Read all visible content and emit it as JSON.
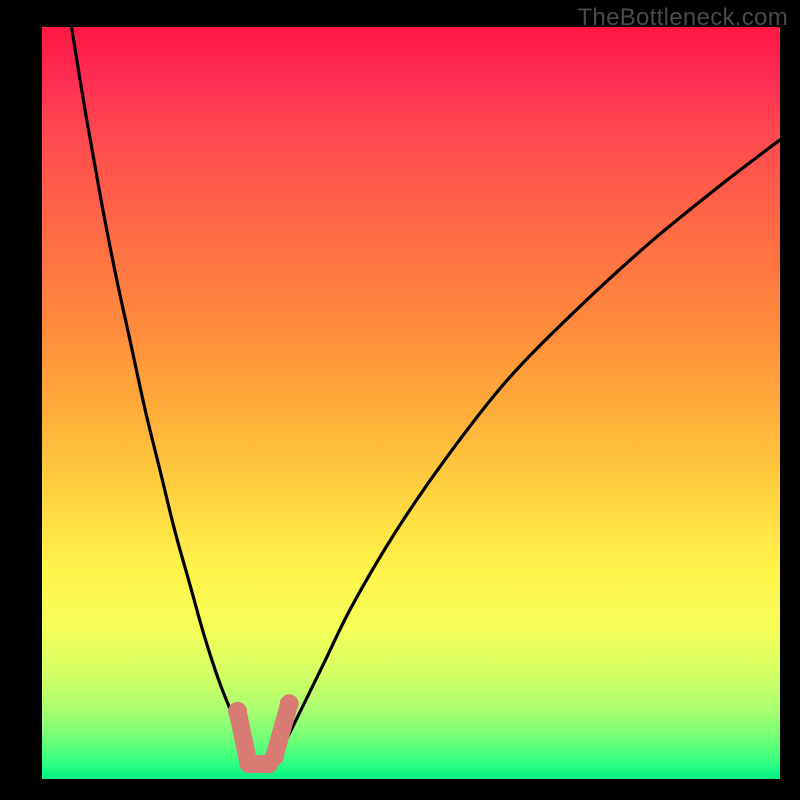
{
  "watermark": "TheBottleneck.com",
  "colors": {
    "background": "#000000",
    "gradient_top": "#ff1744",
    "gradient_mid1": "#ff8b3c",
    "gradient_mid2": "#fff34a",
    "gradient_bottom": "#00ef86",
    "curve": "#000000",
    "marker": "#d87b74"
  },
  "chart_data": {
    "type": "line",
    "title": "",
    "xlabel": "",
    "ylabel": "",
    "xlim": [
      0,
      100
    ],
    "ylim": [
      0,
      100
    ],
    "series": [
      {
        "name": "bottleneck-curve",
        "x": [
          4,
          6,
          8,
          10,
          12,
          14,
          16,
          18,
          20,
          22,
          24,
          26,
          27,
          28,
          29,
          30,
          31,
          32,
          33,
          35,
          38,
          42,
          48,
          55,
          63,
          72,
          82,
          92,
          100
        ],
        "y": [
          100,
          88,
          77,
          67,
          58,
          49,
          41,
          33,
          26,
          19,
          13,
          8,
          5,
          3,
          2,
          2,
          2,
          3,
          5,
          9,
          15,
          23,
          33,
          43,
          53,
          62,
          71,
          79,
          85
        ]
      }
    ],
    "markers": [
      {
        "name": "left-cluster",
        "x_range": [
          26.5,
          29.5
        ],
        "y_range": [
          2,
          9
        ]
      },
      {
        "name": "right-cluster",
        "x_range": [
          31.5,
          33.5
        ],
        "y_range": [
          3,
          10
        ]
      }
    ],
    "annotations": []
  }
}
